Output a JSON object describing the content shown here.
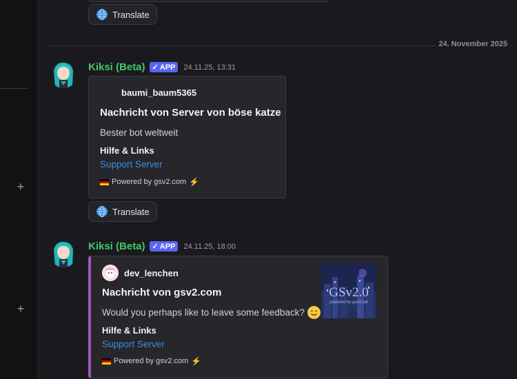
{
  "translate_label": "Translate",
  "date_separator": "24. November 2025",
  "messages": [
    {
      "username": "Kiksi (Beta)",
      "badge": "APP",
      "timestamp": "24.11.25, 13:31",
      "embed": {
        "author": "baumi_baum5365",
        "title": "Nachricht von Server von böse katze",
        "description": "Bester bot weltweit",
        "field_name": "Hilfe & Links",
        "link_text": "Support Server",
        "footer": "Powered by gsv2.com"
      }
    },
    {
      "username": "Kiksi (Beta)",
      "badge": "APP",
      "timestamp": "24.11.25, 18:00",
      "embed": {
        "author": "dev_lenchen",
        "title": "Nachricht von gsv2.com",
        "description": "Would you perhaps like to leave some feedback?",
        "field_name": "Hilfe & Links",
        "link_text": "Support Server",
        "footer": "Powered by gsv2.com",
        "thumbnail_text": "GSv2.0",
        "thumbnail_subtext": "powered by gsv2.net"
      }
    }
  ],
  "colors": {
    "username": "#43c766",
    "app_badge": "#5865f2",
    "link": "#3c8ddb",
    "embed_accent": "#9b59b6"
  }
}
